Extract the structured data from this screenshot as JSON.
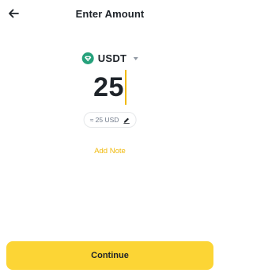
{
  "header": {
    "title": "Enter Amount",
    "back_icon": "arrow-left-icon"
  },
  "asset": {
    "symbol": "USDT",
    "icon": "tether-diamond-icon",
    "icon_color": "#26a17b"
  },
  "amount": {
    "value": "25",
    "fiat_equivalent": "≈ 25 USD",
    "edit_icon": "pencil-icon"
  },
  "note": {
    "add_label": "Add Note"
  },
  "footer": {
    "continue_label": "Continue"
  },
  "colors": {
    "accent": "#f0b90b",
    "button": "#fcd535",
    "text": "#1e2329",
    "muted": "#707a8a"
  }
}
